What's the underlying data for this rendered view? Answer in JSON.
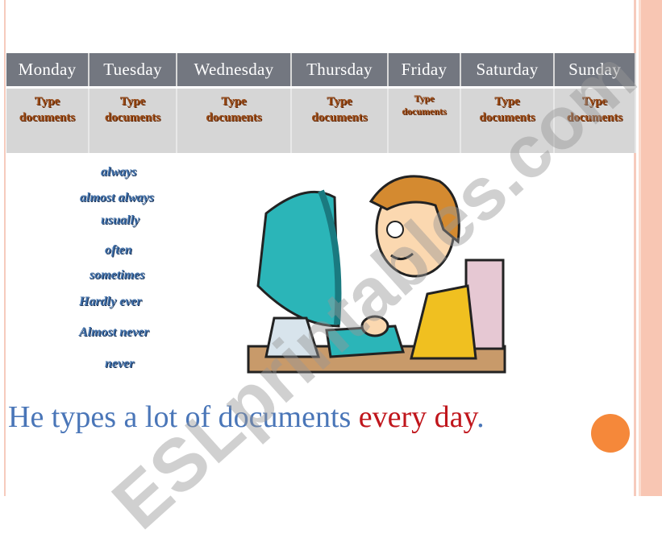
{
  "table": {
    "headers": [
      "Monday",
      "Tuesday",
      "Wednesday",
      "Thursday",
      "Friday",
      "Saturday",
      "Sunday"
    ],
    "cells": [
      {
        "line1": "Type",
        "line2": "documents"
      },
      {
        "line1": "Type",
        "line2": "documents"
      },
      {
        "line1": "Type",
        "line2": "documents"
      },
      {
        "line1": "Type",
        "line2": "documents"
      },
      {
        "line1": "Type",
        "line2": "documents"
      },
      {
        "line1": "Type",
        "line2": "documents"
      },
      {
        "line1": "Type",
        "line2": "documents"
      }
    ]
  },
  "frequency_words": [
    "always",
    "almost always",
    "usually",
    "often",
    "sometimes",
    "Hardly ever",
    "Almost never",
    "never"
  ],
  "sentence": {
    "part1": "He  types a lot of documents ",
    "part2": "every day",
    "part3": "."
  },
  "watermark": "ESLprintables.com",
  "colors": {
    "accent_stripe": "#f9c9b7",
    "header_bg": "#737780",
    "cell_bg": "#d6d6d6",
    "blue_text": "#4a76b8",
    "red_text": "#c0161c",
    "bullet": "#f5883a"
  }
}
